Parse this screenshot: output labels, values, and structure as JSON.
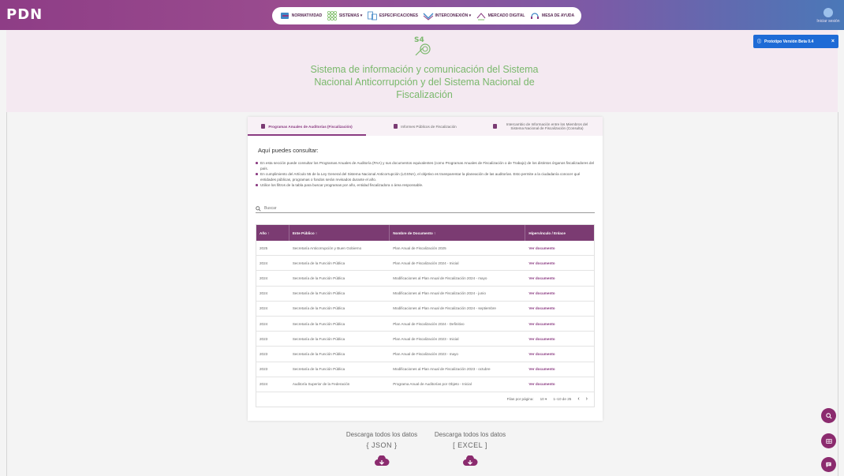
{
  "header": {
    "logo": "PDN",
    "nav": [
      {
        "label": "NORMATIVIDAD",
        "icon": "gavel-icon"
      },
      {
        "label": "SISTEMAS ▾",
        "icon": "grid-icon"
      },
      {
        "label": "ESPECIFICACIONES",
        "icon": "spec-doc-icon"
      },
      {
        "label": "INTERCONEXIÓN ▾",
        "icon": "network-icon"
      },
      {
        "label": "MERCADO DIGITAL",
        "icon": "market-icon"
      },
      {
        "label": "MESA DE AYUDA",
        "icon": "help-desk-icon"
      }
    ],
    "login_label": "Iniciar sesión"
  },
  "hero": {
    "logo_text": "S4",
    "title": "Sistema de información y comunicación del Sistema Nacional Anticorrupción y del Sistema Nacional de Fiscalización"
  },
  "beta_badge": {
    "label": "Prototipo Versión Beta 0.4",
    "close": "×"
  },
  "tabs": [
    {
      "label": "Programas Anuales de Auditorías (Fiscalización)",
      "active": true
    },
    {
      "label": "Informes Públicos de Fiscalización",
      "active": false
    },
    {
      "label": "Intercambio de Información entre los Miembros del Sistema Nacional de Fiscalización (Consulta)",
      "active": false
    }
  ],
  "consult": {
    "title": "Aquí puedes consultar:",
    "bullets": [
      "En esta sección puede consultar los Programas Anuales de Auditoría (PAA) y sus documentos equivalentes (como Programas Anuales de Fiscalización o de Trabajo) de los distintos órganos fiscalizadores del país.",
      "En cumplimiento del Artículo 55 de la Ley General del Sistema Nacional Anticorrupción (LGSNA), el objetivo es transparentar la planeación de las auditorías. Esto permite a la ciudadanía conocer qué entidades públicas, programas o fondos serán revisados durante el año.",
      "Utilice los filtros de la tabla para buscar programas por año, entidad fiscalizadora o área responsable."
    ]
  },
  "search": {
    "placeholder": "Buscar"
  },
  "table": {
    "headers": [
      "Año ↑",
      "Ente Público ↑",
      "Nombre de Documento ↑",
      "Hipervínculo / Enlace"
    ],
    "rows": [
      [
        "2025",
        "Secretaría Anticorrupción y Buen Gobierno",
        "Plan Anual de Fiscalización 2025",
        "Ver documento"
      ],
      [
        "2024",
        "Secretaría de la Función Pública",
        "Plan Anual de Fiscalización 2024 - Inicial",
        "Ver documento"
      ],
      [
        "2024",
        "Secretaría de la Función Pública",
        "Modificaciones al Plan Anual de Fiscalización 2024 - mayo",
        "Ver documento"
      ],
      [
        "2024",
        "Secretaría de la Función Pública",
        "Modificaciones al Plan Anual de Fiscalización 2024 - junio",
        "Ver documento"
      ],
      [
        "2024",
        "Secretaría de la Función Pública",
        "Modificaciones al Plan Anual de Fiscalización 2024 - septiembre",
        "Ver documento"
      ],
      [
        "2024",
        "Secretaría de la Función Pública",
        "Plan Anual de Fiscalización 2024 - Definitivo",
        "Ver documento"
      ],
      [
        "2023",
        "Secretaría de la Función Pública",
        "Plan Anual de Fiscalización 2023 - Inicial",
        "Ver documento"
      ],
      [
        "2023",
        "Secretaría de la Función Pública",
        "Plan Anual de Fiscalización 2023 - mayo",
        "Ver documento"
      ],
      [
        "2023",
        "Secretaría de la Función Pública",
        "Modificaciones al Plan Anual de Fiscalización 2023 - octubre",
        "Ver documento"
      ],
      [
        "2024",
        "Auditoría Superior de la Federación",
        "Programa Anual de Auditorías por Objeto - Inicial",
        "Ver documento"
      ]
    ],
    "pager": {
      "rows_label": "Filas por página:",
      "rows_value": "10 ▾",
      "range": "1–10 de 25",
      "prev": "‹",
      "next": "›"
    }
  },
  "downloads": [
    {
      "title": "Descarga todos los datos",
      "format": "{ JSON }"
    },
    {
      "title": "Descarga todos los datos",
      "format": "[ EXCEL ]"
    }
  ],
  "colors": {
    "brand": "#8b3c82",
    "accent_green": "#7ab86c",
    "beta_blue": "#1e6bd6"
  }
}
